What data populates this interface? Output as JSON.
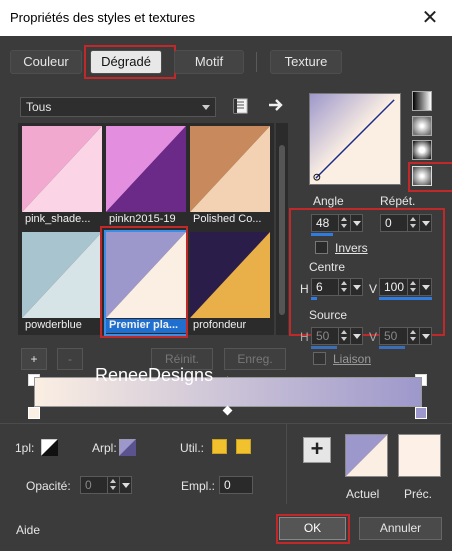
{
  "window": {
    "title": "Propriétés des styles et textures",
    "close_label": "✕"
  },
  "tabs": [
    {
      "label": "Couleur",
      "active": false
    },
    {
      "label": "Dégradé",
      "active": true
    },
    {
      "label": "Motif",
      "active": false
    },
    {
      "label": "Texture",
      "active": false
    }
  ],
  "category_select": {
    "value": "Tous"
  },
  "gradients": [
    {
      "name": "pink_shade...",
      "colors": [
        "#f2a9d0",
        "#fbd4e6"
      ],
      "selected": false
    },
    {
      "name": "pinkn2015-19",
      "colors": [
        "#6b2a88",
        "#e48ee0"
      ],
      "selected": false
    },
    {
      "name": "Polished Co...",
      "colors": [
        "#c8895c",
        "#f3d2b3"
      ],
      "selected": false
    },
    {
      "name": "powderblue",
      "colors": [
        "#a8c5cf",
        "#d6e3e7"
      ],
      "selected": false
    },
    {
      "name": "Premier pla...",
      "colors": [
        "#9d98cb",
        "#fbefe3"
      ],
      "selected": true
    },
    {
      "name": "profondeur",
      "colors": [
        "#2a1d4a",
        "#e9b04a"
      ],
      "selected": false
    }
  ],
  "preview": {
    "colors": [
      "#9d98cb",
      "#fbefe3"
    ]
  },
  "angle": {
    "label": "Angle",
    "value": "48"
  },
  "repeat": {
    "label": "Répét.",
    "value": "0"
  },
  "invert": {
    "label": "Invers",
    "checked": false
  },
  "center": {
    "label": "Centre",
    "h_label": "H",
    "h_value": "6",
    "v_label": "V",
    "v_value": "100"
  },
  "source": {
    "label": "Source",
    "h_label": "H",
    "h_value": "50",
    "v_label": "V",
    "v_value": "50"
  },
  "link": {
    "label": "Liaison",
    "checked": false
  },
  "list_buttons": {
    "add": "+",
    "remove": "-",
    "reset": "Réinit.",
    "save": "Enreg."
  },
  "gradient_editor": {
    "watermark": "ReneeDesigns",
    "stops": [
      "#fbefe3",
      "#9d98cb"
    ]
  },
  "stop_props": {
    "first_label": "1pl:",
    "back_label": "Arpl:",
    "use_label": "Util.:",
    "opacity_label": "Opacité:",
    "opacity_value": "0",
    "location_label": "Empl.:",
    "location_value": "0",
    "use_color": "#f2c12e"
  },
  "current": {
    "label": "Actuel",
    "colors": [
      "#9d98cb",
      "#fbefe3"
    ]
  },
  "previous": {
    "label": "Préc.",
    "color": "#fdf1e7"
  },
  "footer": {
    "help": "Aide",
    "ok": "OK",
    "cancel": "Annuler"
  },
  "accent": "#2f7be0",
  "highlight": "#c0282a"
}
